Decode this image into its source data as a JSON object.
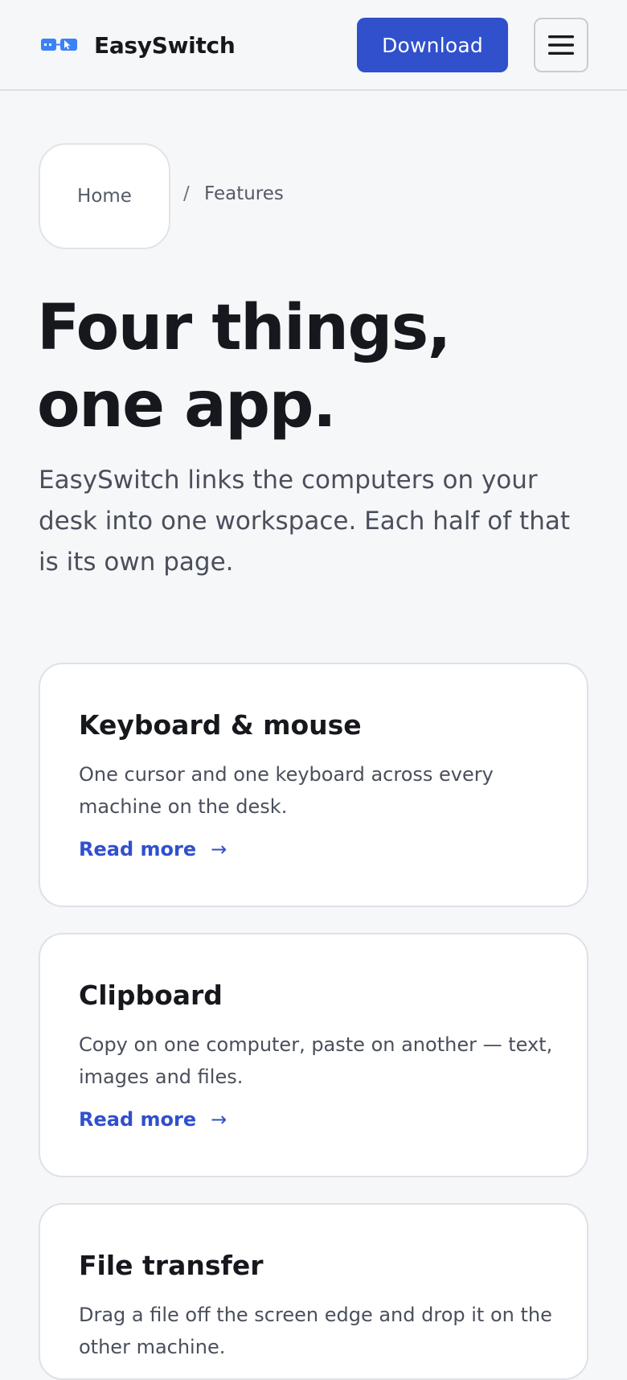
{
  "header": {
    "brand_name": "EasySwitch",
    "logo_icon": "two-screens-cursor-icon",
    "download_label": "Download",
    "menu_icon": "hamburger-menu-icon"
  },
  "breadcrumb": {
    "home": "Home",
    "separator": "/",
    "current": "Features"
  },
  "hero": {
    "title_line1": "Four things,",
    "title_line2": "one app.",
    "subtitle": "EasySwitch links the computers on your desk into one workspace. Each half of that is its own page."
  },
  "features": [
    {
      "title": "Keyboard & mouse",
      "description": "One cursor and one keyboard across every machine on the desk.",
      "link_label": "Read more",
      "link_icon": "arrow-right-icon"
    },
    {
      "title": "Clipboard",
      "description": "Copy on one computer, paste on another — text, images and files.",
      "link_label": "Read more",
      "link_icon": "arrow-right-icon"
    },
    {
      "title": "File transfer",
      "description": "Drag a file off the screen edge and drop it on the other machine."
    }
  ],
  "colors": {
    "accent": "#3050cc",
    "background": "#f6f7f9",
    "card": "#ffffff",
    "text": "#16181d",
    "muted_text": "#4a4f5b"
  }
}
